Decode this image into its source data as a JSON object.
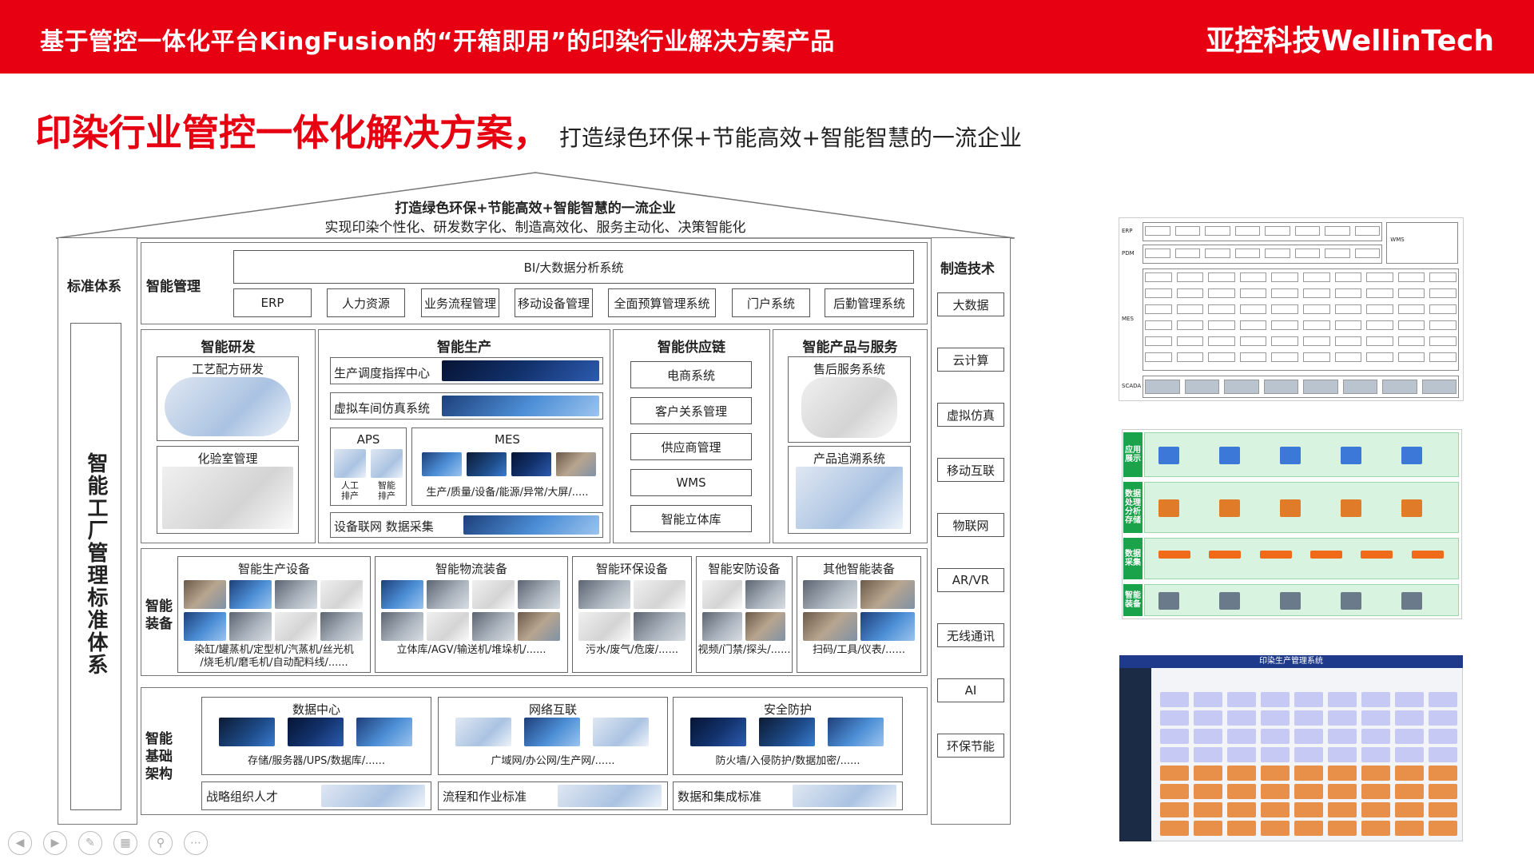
{
  "header": {
    "title": "基于管控一体化平台KingFusion的“开箱即用”的印染行业解决方案产品",
    "brand": "亚控科技WellinTech"
  },
  "headline": {
    "main": "印染行业管控一体化解决方案，",
    "sub": "打造绿色环保+节能高效+智能智慧的一流企业"
  },
  "roof": {
    "line1": "打造绿色环保+节能高效+智能智慧的一流企业",
    "line2": "实现印染个性化、研发数字化、制造高效化、服务主动化、决策智能化"
  },
  "left_column": {
    "title": "标准体系",
    "vertical": "智能工厂管理标准体系"
  },
  "right_column": {
    "title": "制造技术",
    "items": [
      "大数据",
      "云计算",
      "虚拟仿真",
      "移动互联",
      "物联网",
      "AR/VR",
      "无线通讯",
      "AI",
      "环保节能"
    ]
  },
  "management": {
    "label": "智能管理",
    "bi": "BI/大数据分析系统",
    "systems": [
      "ERP",
      "人力资源",
      "业务流程管理",
      "移动设备管理",
      "全面预算管理系统",
      "门户系统",
      "后勤管理系统"
    ]
  },
  "rd": {
    "title": "智能研发",
    "blocks": [
      "工艺配方研发",
      "化验室管理"
    ]
  },
  "production": {
    "title": "智能生产",
    "dispatch": "生产调度指挥中心",
    "virtual": "虚拟车间仿真系统",
    "aps": "APS",
    "aps_sub": [
      "人工\n排产",
      "智能\n排产"
    ],
    "mes": "MES",
    "mes_caption": "生产/质量/设备/能源/异常/大屏/.....",
    "iot": "设备联网 数据采集"
  },
  "supply": {
    "title": "智能供应链",
    "items": [
      "电商系统",
      "客户关系管理",
      "供应商管理",
      "WMS",
      "智能立体库"
    ]
  },
  "service": {
    "title": "智能产品与服务",
    "blocks": [
      "售后服务系统",
      "产品追溯系统"
    ]
  },
  "equipment": {
    "label": "智能\n装备",
    "groups": [
      {
        "title": "智能生产设备",
        "caption": "染缸/罐蒸机/定型机/汽蒸机/丝光机\n/烧毛机/磨毛机/自动配料线/......"
      },
      {
        "title": "智能物流装备",
        "caption": "立体库/AGV/输送机/堆垛机/......"
      },
      {
        "title": "智能环保设备",
        "caption": "污水/废气/危废/......"
      },
      {
        "title": "智能安防设备",
        "caption": "视频/门禁/探头/......"
      },
      {
        "title": "其他智能装备",
        "caption": "扫码/工具/仪表/......"
      }
    ]
  },
  "infra": {
    "label": "智能\n基础\n架构",
    "groups": [
      {
        "title": "数据中心",
        "caption": "存储/服务器/UPS/数据库/......"
      },
      {
        "title": "网络互联",
        "caption": "广域网/办公网/生产网/......"
      },
      {
        "title": "安全防护",
        "caption": "防火墙/入侵防护/数据加密/......"
      }
    ],
    "bottom": [
      "战略组织人才",
      "流程和作业标准",
      "数据和集成标准"
    ]
  },
  "thumbs": {
    "arch_rows": [
      "ERP",
      "PDM",
      "MES",
      "SCADA"
    ],
    "arch_side": "WMS",
    "layers": [
      "应用\n展示",
      "数据\n处理\n分析\n存储",
      "数据\n采集",
      "智能\n装备"
    ],
    "schedule_title": "印染生产管理系统"
  },
  "colors": {
    "brand_red": "#e60012",
    "layer_green": "#1aa34a",
    "schedule_navy": "#1f3a8a"
  }
}
